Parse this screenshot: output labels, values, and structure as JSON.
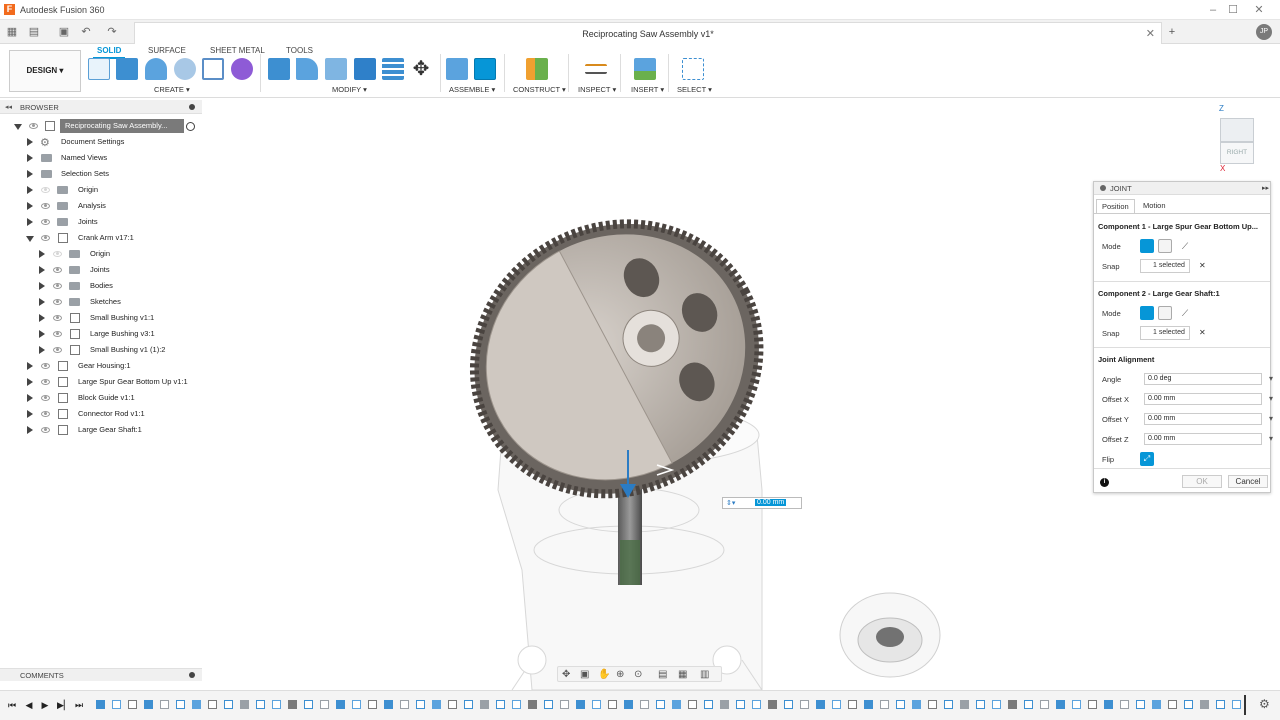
{
  "window": {
    "app_title": "Autodesk Fusion 360",
    "logo_letter": "F",
    "minimize": "–",
    "maximize": "☐",
    "close": "✕"
  },
  "qat": {
    "grid": "▦",
    "file": "▤",
    "save": "▣",
    "undo": "↶",
    "redo": "↷",
    "add_tab": "+",
    "user": "JP"
  },
  "document": {
    "title": "Reciprocating Saw Assembly v1*",
    "close": "✕"
  },
  "ribbon": {
    "workspace": "DESIGN ▾",
    "tabs": [
      "SOLID",
      "SURFACE",
      "SHEET METAL",
      "TOOLS"
    ],
    "groups": [
      "CREATE ▾",
      "MODIFY ▾",
      "ASSEMBLE ▾",
      "CONSTRUCT ▾",
      "INSPECT ▾",
      "INSERT ▾",
      "SELECT ▾"
    ]
  },
  "browser": {
    "title": "BROWSER",
    "collapse": "◂◂",
    "items": [
      "Reciprocating Saw Assembly...",
      "Document Settings",
      "Named Views",
      "Selection Sets",
      "Origin",
      "Analysis",
      "Joints",
      "Crank Arm v17:1",
      "Origin",
      "Joints",
      "Bodies",
      "Sketches",
      "Small Bushing v1:1",
      "Large Bushing v3:1",
      "Small Bushing v1 (1):2",
      "Gear Housing:1",
      "Large Spur Gear Bottom Up v1:1",
      "Block Guide v1:1",
      "Connector Rod v1:1",
      "Large Gear Shaft:1"
    ]
  },
  "comments": {
    "title": "COMMENTS"
  },
  "viewcube": {
    "face": "RIGHT",
    "axis_z": "Z",
    "axis_x": "X"
  },
  "viewport": {
    "offset_value": "0.00 mm"
  },
  "joint": {
    "title": "JOINT",
    "tabs": [
      "Position",
      "Motion"
    ],
    "component1": {
      "header": "Component 1 - Large Spur Gear Bottom Up...",
      "mode_label": "Mode",
      "snap_label": "Snap",
      "snap_value": "1 selected"
    },
    "component2": {
      "header": "Component 2 - Large Gear Shaft:1",
      "mode_label": "Mode",
      "snap_label": "Snap",
      "snap_value": "1 selected"
    },
    "alignment": {
      "header": "Joint Alignment",
      "angle_label": "Angle",
      "angle_value": "0.0 deg",
      "offset_x_label": "Offset X",
      "offset_x_value": "0.00 mm",
      "offset_y_label": "Offset Y",
      "offset_y_value": "0.00 mm",
      "offset_z_label": "Offset Z",
      "offset_z_value": "0.00 mm",
      "flip_label": "Flip"
    },
    "info": "i",
    "ok": "OK",
    "cancel": "Cancel",
    "clear": "✕"
  },
  "colors": {
    "accent": "#0696d7",
    "orange": "#f26b1d"
  }
}
